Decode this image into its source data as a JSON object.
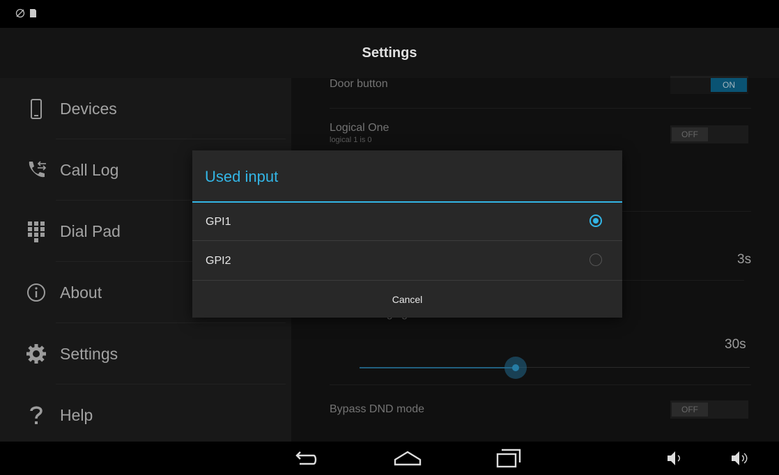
{
  "status_bar": {
    "icons": [
      "rotation-lock-icon",
      "sd-card-icon"
    ]
  },
  "header": {
    "title": "Settings"
  },
  "sidebar": {
    "items": [
      {
        "label": "Devices",
        "icon": "phone-device-icon"
      },
      {
        "label": "Call Log",
        "icon": "call-log-icon"
      },
      {
        "label": "Dial Pad",
        "icon": "dialpad-icon"
      },
      {
        "label": "About",
        "icon": "info-icon"
      },
      {
        "label": "Settings",
        "icon": "gear-icon"
      },
      {
        "label": "Help",
        "icon": "question-icon"
      }
    ]
  },
  "settings": {
    "door_button": {
      "label": "Door button",
      "state": "ON"
    },
    "logical_one": {
      "label": "Logical One",
      "sublabel": "logical 1 is 0",
      "state": "OFF"
    },
    "delay_value": "3s",
    "ringing_label": "Maximal ringing time",
    "ringing_value": "30s",
    "ringing_slider_fraction": 0.4,
    "bypass_dnd": {
      "label": "Bypass DND mode",
      "state": "OFF"
    }
  },
  "dialog": {
    "title": "Used input",
    "options": [
      {
        "label": "GPI1",
        "selected": true
      },
      {
        "label": "GPI2",
        "selected": false
      }
    ],
    "cancel_label": "Cancel"
  },
  "nav_bar": {
    "icons": [
      "back-icon",
      "home-icon",
      "recent-apps-icon",
      "volume-down-icon",
      "volume-up-icon"
    ]
  },
  "colors": {
    "accent": "#33b5e5",
    "background": "#161616",
    "sidebar": "#202020"
  }
}
